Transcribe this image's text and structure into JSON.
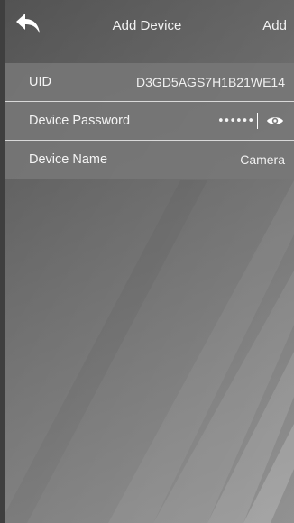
{
  "header": {
    "title": "Add Device",
    "add_label": "Add"
  },
  "form": {
    "uid": {
      "label": "UID",
      "value": "D3GD5AGS7H1B21WE14"
    },
    "password": {
      "label": "Device Password",
      "value": "••••••"
    },
    "name": {
      "label": "Device Name",
      "value": "Camera"
    }
  },
  "icons": {
    "back": "back-arrow-icon",
    "eye": "eye-icon"
  },
  "colors": {
    "text": "#ffffff",
    "panel": "#7a7a7a",
    "divider": "#d9d9d9"
  }
}
